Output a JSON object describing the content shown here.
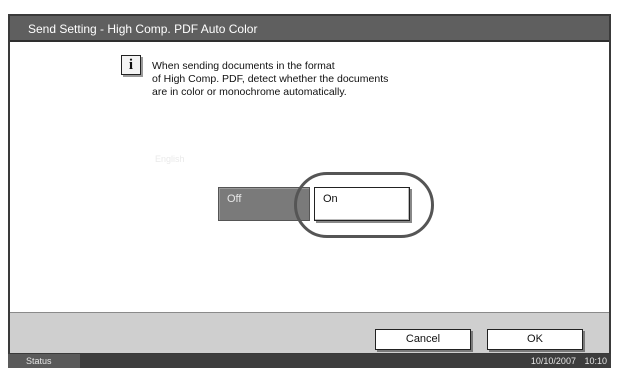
{
  "title": "Send Setting - High Comp. PDF Auto Color",
  "info": {
    "icon": "info-icon",
    "icon_glyph": "i",
    "lines": [
      "When sending documents in the format",
      "of High Comp. PDF, detect whether the documents",
      "are in color or monochrome automatically."
    ]
  },
  "hint_text": "English",
  "options": {
    "off_label": "Off",
    "on_label": "On",
    "selected": "On"
  },
  "footer": {
    "cancel_label": "Cancel",
    "ok_label": "OK"
  },
  "status": {
    "label": "Status",
    "date": "10/10/2007",
    "time": "10:10"
  },
  "colors": {
    "title_bg": "#5f5f5f",
    "off_button_bg": "#7a7a7a",
    "footer_bg": "#cfcfcf",
    "status_bg": "#3d3d3d"
  }
}
